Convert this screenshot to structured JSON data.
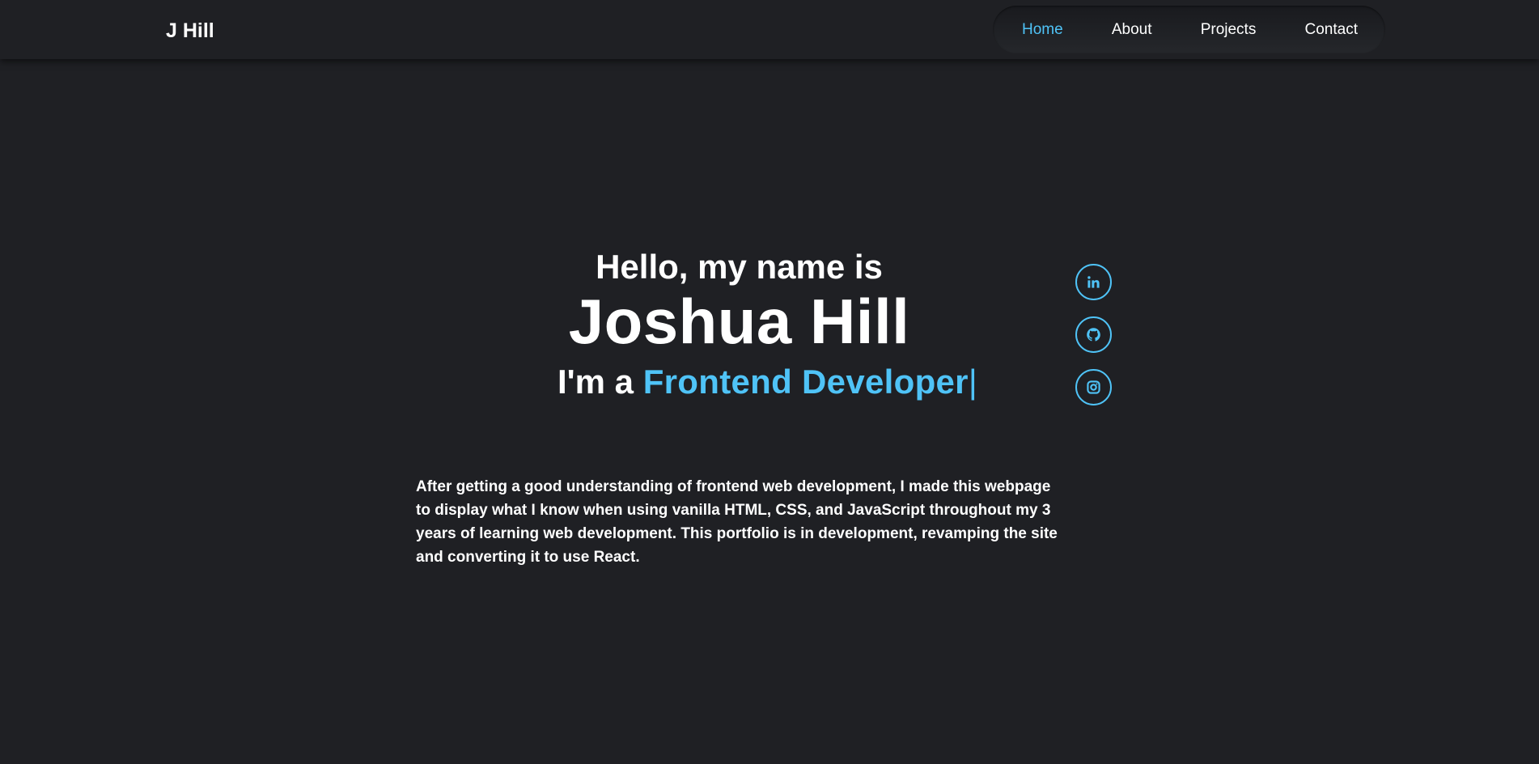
{
  "header": {
    "logo": "J Hill",
    "nav": [
      {
        "label": "Home",
        "active": true
      },
      {
        "label": "About",
        "active": false
      },
      {
        "label": "Projects",
        "active": false
      },
      {
        "label": "Contact",
        "active": false
      }
    ]
  },
  "hero": {
    "greeting": "Hello, my name is",
    "name": "Joshua Hill",
    "role_prefix": "I'm a ",
    "role": "Frontend Developer",
    "cursor": "|"
  },
  "socials": [
    {
      "name": "linkedin-icon"
    },
    {
      "name": "github-icon"
    },
    {
      "name": "instagram-icon"
    }
  ],
  "about": {
    "text": "After getting a good understanding of frontend web development, I made this webpage to display what I know when using vanilla HTML, CSS, and JavaScript throughout my 3 years of learning web development. This portfolio is in development, revamping the site and converting it to use React."
  },
  "colors": {
    "background": "#1f2024",
    "accent": "#4fc3f7",
    "text": "#ffffff"
  }
}
